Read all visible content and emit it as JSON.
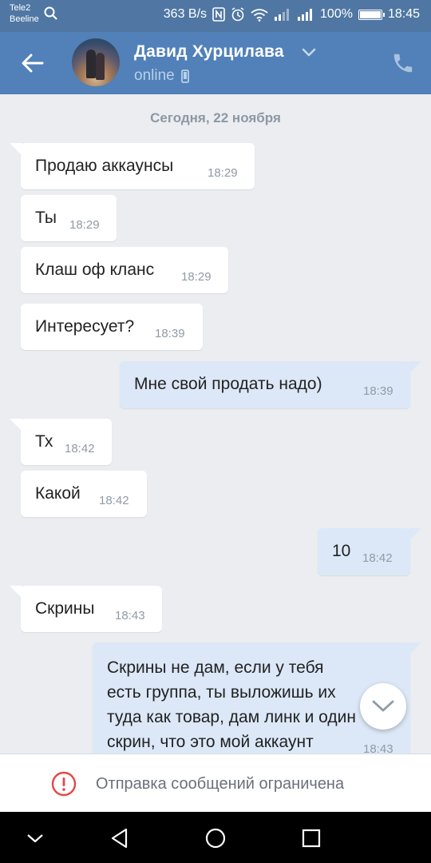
{
  "status_bar": {
    "carrier1": "Tele2",
    "carrier2": "Beeline",
    "speed": "363 B/s",
    "battery": "100%",
    "time": "18:45",
    "battery_level": 1.0
  },
  "header": {
    "contact_name": "Давид Хурцилава",
    "status": "online",
    "icons": [
      "back-arrow-icon",
      "chevron-down-icon",
      "mobile-device-icon",
      "phone-icon"
    ]
  },
  "chat": {
    "date_divider": "Сегодня, 22 ноября",
    "messages": [
      {
        "dir": "in",
        "text": "Продаю аккаунсы",
        "time": "18:29"
      },
      {
        "dir": "in",
        "text": "Ты",
        "time": "18:29"
      },
      {
        "dir": "in",
        "text": "Клаш оф кланс",
        "time": "18:29"
      },
      {
        "dir": "in",
        "text": "Интересует?",
        "time": "18:39"
      },
      {
        "dir": "out",
        "text": "Мне свой продать надо)",
        "time": "18:39"
      },
      {
        "dir": "in",
        "text": "Тх",
        "time": "18:42"
      },
      {
        "dir": "in",
        "text": "Какой",
        "time": "18:42"
      },
      {
        "dir": "out",
        "text": "10",
        "time": "18:42"
      },
      {
        "dir": "in",
        "text": "Скрины",
        "time": "18:43"
      },
      {
        "dir": "out",
        "lines": [
          "Скрины не дам, если у тебя",
          "есть группа, ты выложишь их",
          "туда как товар, дам линк и один",
          "скрин, что это мой аккаунт"
        ],
        "time": "18:43"
      }
    ]
  },
  "restricted_notice": "Отправка сообщений ограничена",
  "colors": {
    "header_bg": "#5181b8",
    "status_bar_bg": "#5077a3",
    "chat_bg": "#ebedf0",
    "incoming_bubble": "#ffffff",
    "outgoing_bubble": "#dce8f7",
    "warning_red": "#e64646"
  },
  "nav_bar": {
    "icons": [
      "hide-keyboard-chevron-icon",
      "back-triangle-icon",
      "home-circle-icon",
      "recents-square-icon"
    ]
  }
}
